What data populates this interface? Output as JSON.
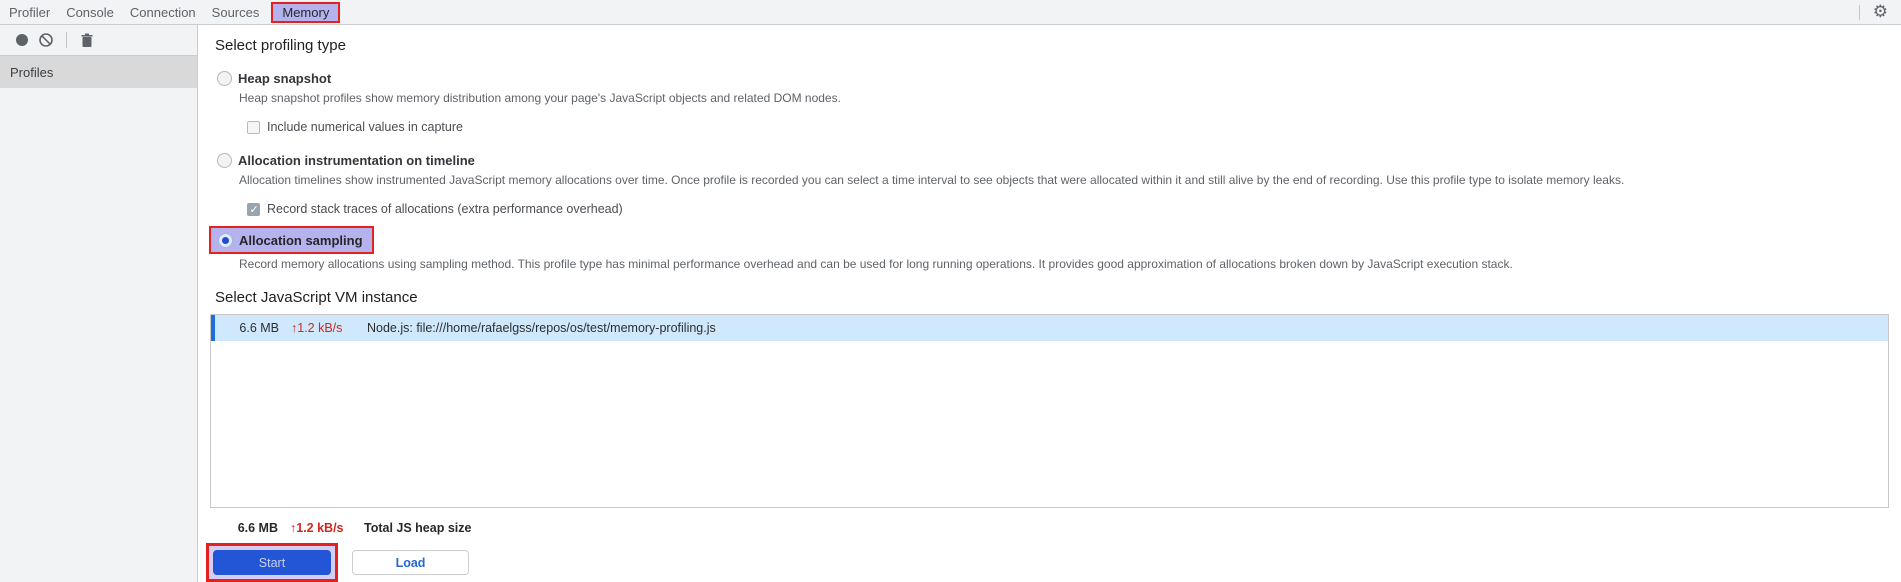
{
  "tabbar": {
    "tabs": [
      {
        "label": "Profiler"
      },
      {
        "label": "Console"
      },
      {
        "label": "Connection"
      },
      {
        "label": "Sources"
      },
      {
        "label": "Memory"
      }
    ],
    "active_tab": "Memory",
    "icons": {
      "settings": "gear-icon",
      "settings_glyph": "⚙"
    }
  },
  "sidebar": {
    "toolbar_icons": [
      "record-icon",
      "clear-icon",
      "trash-icon"
    ],
    "header": "Profiles"
  },
  "main": {
    "heading_profiling": "Select profiling type",
    "options": [
      {
        "label": "Heap snapshot",
        "desc": "Heap snapshot profiles show memory distribution among your page's JavaScript objects and related DOM nodes.",
        "selected": false
      },
      {
        "label": "Allocation instrumentation on timeline",
        "desc": "Allocation timelines show instrumented JavaScript memory allocations over time. Once profile is recorded you can select a time interval to see objects that were allocated within it and still alive by the end of recording. Use this profile type to isolate memory leaks.",
        "selected": false
      },
      {
        "label": "Allocation sampling",
        "desc": "Record memory allocations using sampling method. This profile type has minimal performance overhead and can be used for long running operations. It provides good approximation of allocations broken down by JavaScript execution stack.",
        "selected": true,
        "highlighted": true
      }
    ],
    "checkboxes": [
      {
        "label": "Include numerical values in capture",
        "checked": false
      },
      {
        "label": "Record stack traces of allocations (extra performance overhead)",
        "checked": true
      }
    ],
    "heading_vm": "Select JavaScript VM instance",
    "vm_list": {
      "rows": [
        {
          "size": "6.6 MB",
          "rate": "↑1.2 kB/s",
          "name": "Node.js: file:///home/rafaelgss/repos/os/test/memory-profiling.js",
          "selected": true
        }
      ]
    },
    "total": {
      "size": "6.6 MB",
      "rate": "↑1.2 kB/s",
      "label": "Total JS heap size"
    },
    "buttons": {
      "start": "Start",
      "load": "Load"
    }
  },
  "colors": {
    "annotation_red": "#e4211f",
    "highlight_purple": "#b5b3ed",
    "row_selected_blue": "#cfe8fc",
    "row_accent_blue": "#1d6fe0",
    "rate_red": "#d3261f",
    "start_button_blue": "#2356d7",
    "load_text_blue": "#2468d4",
    "toolbar_grey": "#f1f3f4"
  }
}
